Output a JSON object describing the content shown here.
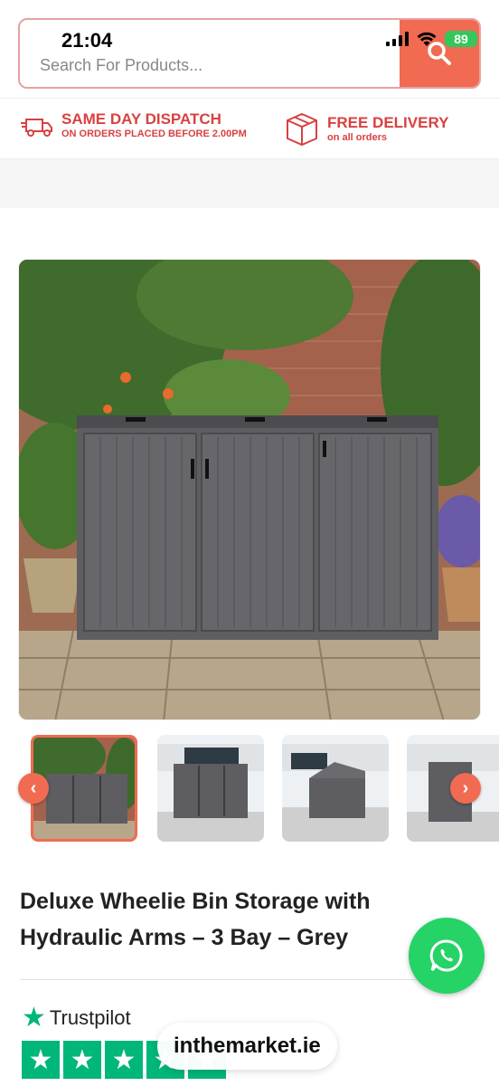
{
  "status_bar": {
    "time": "21:04",
    "battery": "89"
  },
  "search": {
    "placeholder": "Search For Products..."
  },
  "promo": {
    "dispatch_title": "SAME DAY DISPATCH",
    "dispatch_sub": "ON ORDERS PLACED BEFORE 2.00PM",
    "delivery_title": "FREE DELIVERY",
    "delivery_sub": "on all orders"
  },
  "product": {
    "title": "Deluxe Wheelie Bin Storage with Hydraulic Arms – 3 Bay – Grey"
  },
  "gallery": {
    "prev": "‹",
    "next": "›"
  },
  "trustpilot": {
    "label": "Trustpilot"
  },
  "site_badge": {
    "label": "inthemarket.ie"
  },
  "colors": {
    "accent": "#f06b52",
    "promo_red": "#d94141",
    "trustpilot_green": "#00b67a",
    "whatsapp_green": "#25d366"
  }
}
